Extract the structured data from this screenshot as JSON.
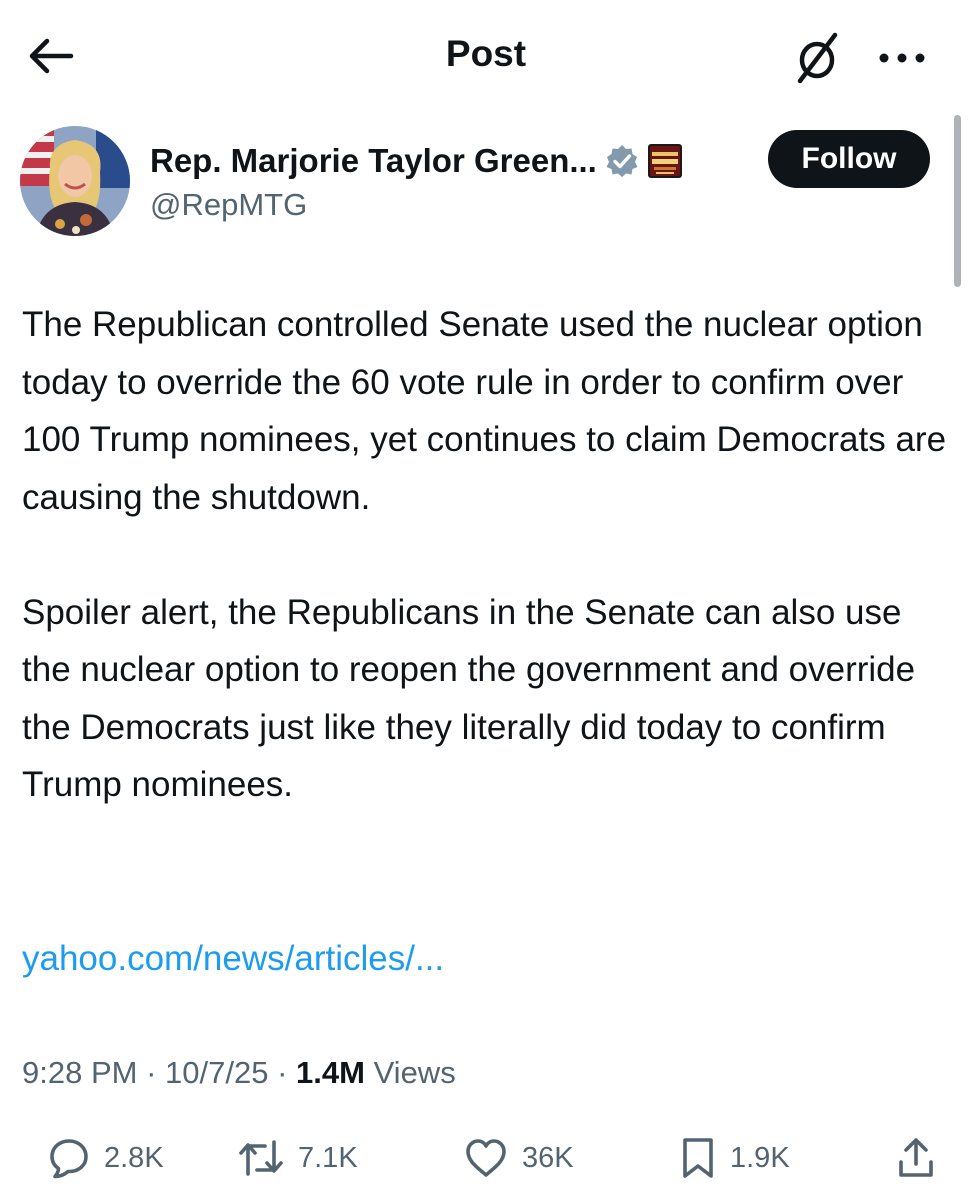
{
  "header": {
    "title": "Post",
    "back_icon": "back-arrow-icon",
    "grok_icon": "grok-icon",
    "more_icon": "more-dots-icon"
  },
  "author": {
    "display_name": "Rep. Marjorie Taylor Green...",
    "handle": "@RepMTG",
    "verified_badge_color": "#829aab",
    "affiliate_badge_text": "THIS IS A DEMOCRAT",
    "follow_label": "Follow"
  },
  "post": {
    "paragraph1": "The Republican controlled Senate used the nuclear option today to override the 60 vote rule in order to confirm over 100 Trump nominees, yet continues to claim Democrats are causing the shutdown.",
    "paragraph2": "Spoiler alert, the Republicans in the Senate can also use the nuclear option to reopen the government and override the Democrats just like they literally did today to confirm Trump nominees.",
    "link": "yahoo.com/news/articles/..."
  },
  "meta": {
    "time": "9:28 PM",
    "date": "10/7/25",
    "separator": " · ",
    "views_count": "1.4M",
    "views_label": "Views"
  },
  "actions": {
    "replies": "2.8K",
    "reposts": "7.1K",
    "likes": "36K",
    "bookmarks": "1.9K"
  },
  "colors": {
    "text": "#0f1419",
    "secondary": "#536471",
    "link": "#1d9bf0",
    "follow_bg": "#0f1419"
  }
}
